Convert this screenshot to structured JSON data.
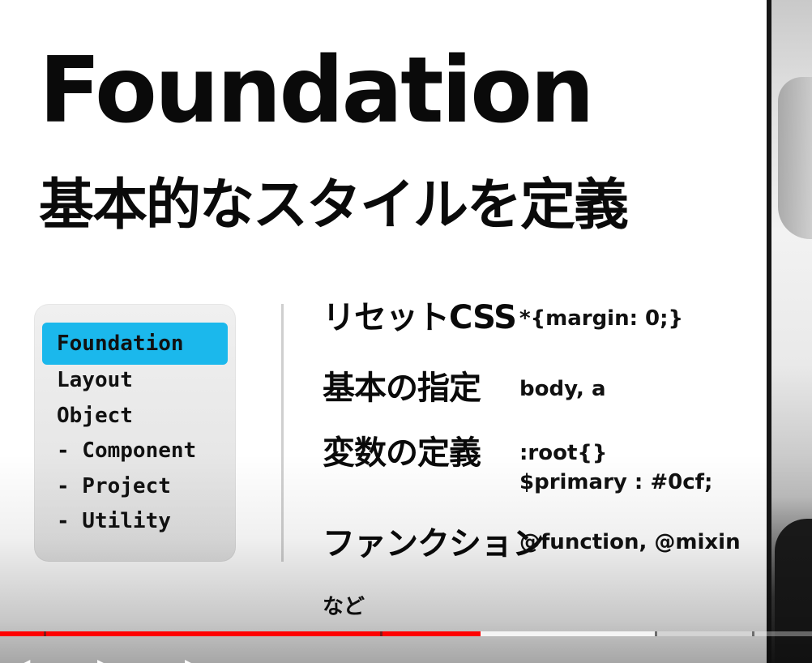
{
  "slide": {
    "title": "Foundation",
    "subtitle": "基本的なスタイルを定義",
    "layers": [
      {
        "label": "Foundation",
        "active": true
      },
      {
        "label": "Layout",
        "active": false
      },
      {
        "label": "Object",
        "active": false
      },
      {
        "label": "- Component",
        "active": false
      },
      {
        "label": "- Project",
        "active": false
      },
      {
        "label": "- Utility",
        "active": false
      }
    ],
    "rows": [
      {
        "label": "リセットCSS",
        "code": "*{margin: 0;}"
      },
      {
        "label": "基本の指定",
        "code": "body, a"
      },
      {
        "label": "変数の定義",
        "code_line1": ":root{}",
        "code_line2": "$primary : #0cf;"
      },
      {
        "label": "ファンクション",
        "code": "@function, @mixin"
      }
    ],
    "note": "など"
  },
  "player": {
    "progress_played_percent": 59.2,
    "progress_loaded_percent": 80.6,
    "played_color": "#ff0000",
    "icons": [
      "previous-icon",
      "play-icon",
      "next-icon"
    ]
  },
  "colors": {
    "accent": "#1bb8ec",
    "text": "#0a0a0a",
    "panel": "#e8e8e8"
  }
}
